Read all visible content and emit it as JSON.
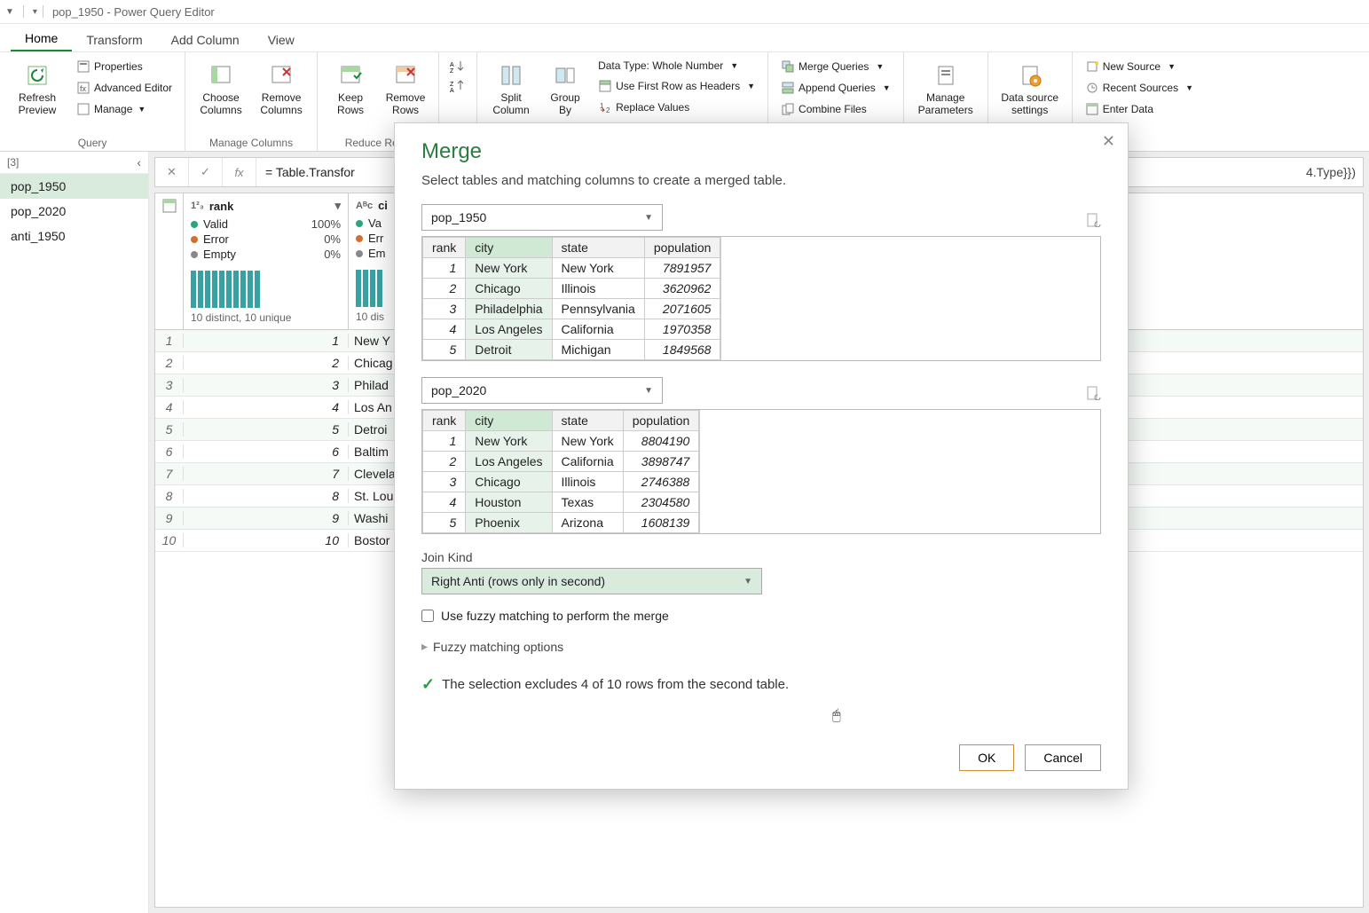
{
  "titlebar": {
    "title": "pop_1950 - Power Query Editor"
  },
  "tabs": [
    "Home",
    "Transform",
    "Add Column",
    "View"
  ],
  "active_tab": "Home",
  "ribbon": {
    "query": {
      "label": "Query",
      "refresh": "Refresh\nPreview",
      "properties": "Properties",
      "adv_editor": "Advanced Editor",
      "manage": "Manage"
    },
    "mc": {
      "label": "Manage Columns",
      "choose": "Choose\nColumns",
      "remove": "Remove\nColumns"
    },
    "rr": {
      "label": "Reduce Rows",
      "keep": "Keep\nRows",
      "remove": "Remove\nRows"
    },
    "sort": {
      "asc": "A→Z",
      "desc": "Z→A"
    },
    "transform": {
      "split": "Split\nColumn",
      "group": "Group\nBy",
      "datatype": "Data Type: Whole Number",
      "firstrow": "Use First Row as Headers",
      "replace": "Replace Values"
    },
    "combine": {
      "merge": "Merge Queries",
      "append": "Append Queries",
      "combine": "Combine Files"
    },
    "params": "Manage\nParameters",
    "ds": "Data source\nsettings",
    "nq": {
      "newsource": "New Source",
      "recent": "Recent Sources",
      "enter": "Enter Data"
    }
  },
  "sidebar": {
    "header": "[3]",
    "items": [
      "pop_1950",
      "pop_2020",
      "anti_1950"
    ],
    "selected": 0
  },
  "formula_bar": {
    "text": "= Table.Transfor",
    "tail": "4.Type}})"
  },
  "profile": {
    "col1": {
      "name": "rank",
      "type": "1²₃",
      "valid": "Valid",
      "valid_pct": "100%",
      "error": "Error",
      "error_pct": "0%",
      "empty": "Empty",
      "empty_pct": "0%",
      "distinct": "10 distinct, 10 unique"
    },
    "col2": {
      "name": "ci",
      "type": "Aᴮc",
      "valid": "Va",
      "error": "Err",
      "empty": "Em",
      "distinct": "10 dis"
    }
  },
  "rows": [
    {
      "idx": "1",
      "rank": "1",
      "city": "New Y"
    },
    {
      "idx": "2",
      "rank": "2",
      "city": "Chicag"
    },
    {
      "idx": "3",
      "rank": "3",
      "city": "Philad"
    },
    {
      "idx": "4",
      "rank": "4",
      "city": "Los An"
    },
    {
      "idx": "5",
      "rank": "5",
      "city": "Detroi"
    },
    {
      "idx": "6",
      "rank": "6",
      "city": "Baltim"
    },
    {
      "idx": "7",
      "rank": "7",
      "city": "Clevela"
    },
    {
      "idx": "8",
      "rank": "8",
      "city": "St. Lou"
    },
    {
      "idx": "9",
      "rank": "9",
      "city": "Washi"
    },
    {
      "idx": "10",
      "rank": "10",
      "city": "Bostor"
    }
  ],
  "modal": {
    "title": "Merge",
    "subtitle": "Select tables and matching columns to create a merged table.",
    "table1": {
      "name": "pop_1950",
      "cols": [
        "rank",
        "city",
        "state",
        "population"
      ],
      "selected_col": "city",
      "rows": [
        {
          "rank": "1",
          "city": "New York",
          "state": "New York",
          "pop": "7891957"
        },
        {
          "rank": "2",
          "city": "Chicago",
          "state": "Illinois",
          "pop": "3620962"
        },
        {
          "rank": "3",
          "city": "Philadelphia",
          "state": "Pennsylvania",
          "pop": "2071605"
        },
        {
          "rank": "4",
          "city": "Los Angeles",
          "state": "California",
          "pop": "1970358"
        },
        {
          "rank": "5",
          "city": "Detroit",
          "state": "Michigan",
          "pop": "1849568"
        }
      ]
    },
    "table2": {
      "name": "pop_2020",
      "cols": [
        "rank",
        "city",
        "state",
        "population"
      ],
      "selected_col": "city",
      "rows": [
        {
          "rank": "1",
          "city": "New York",
          "state": "New York",
          "pop": "8804190"
        },
        {
          "rank": "2",
          "city": "Los Angeles",
          "state": "California",
          "pop": "3898747"
        },
        {
          "rank": "3",
          "city": "Chicago",
          "state": "Illinois",
          "pop": "2746388"
        },
        {
          "rank": "4",
          "city": "Houston",
          "state": "Texas",
          "pop": "2304580"
        },
        {
          "rank": "5",
          "city": "Phoenix",
          "state": "Arizona",
          "pop": "1608139"
        }
      ]
    },
    "join_label": "Join Kind",
    "join_kind": "Right Anti (rows only in second)",
    "fuzzy_check": "Use fuzzy matching to perform the merge",
    "fuzzy_options": "Fuzzy matching options",
    "status": "The selection excludes 4 of 10 rows from the second table.",
    "ok": "OK",
    "cancel": "Cancel"
  }
}
